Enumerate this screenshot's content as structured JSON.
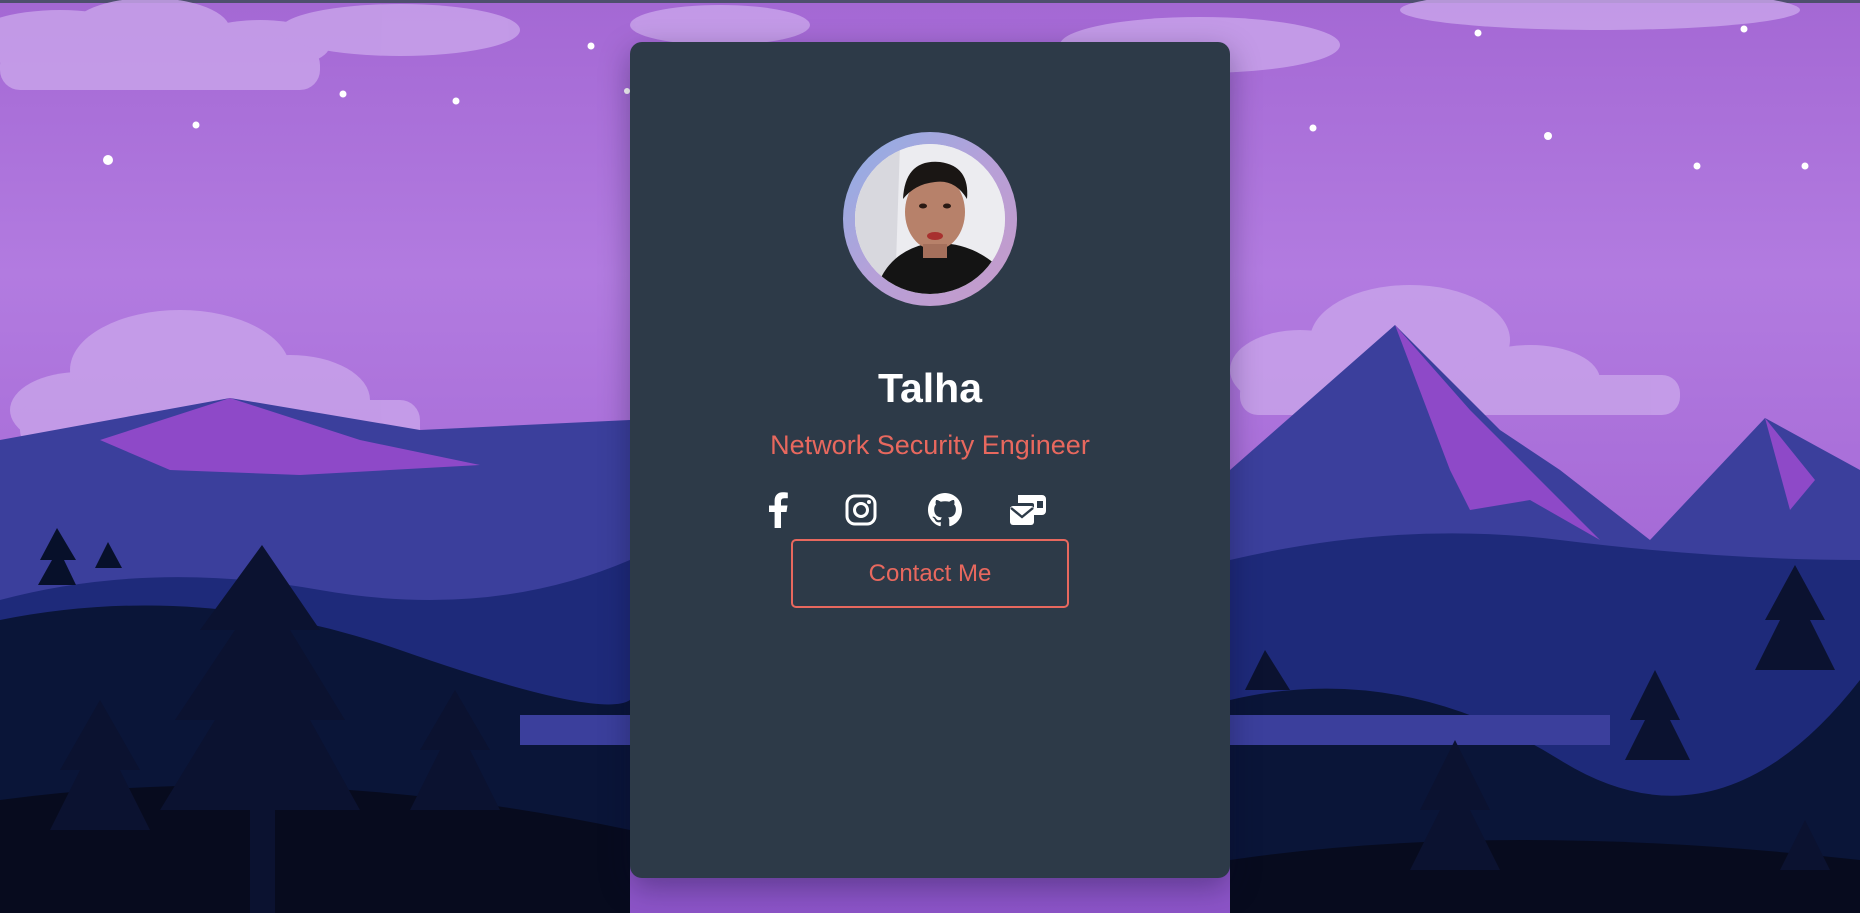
{
  "profile": {
    "name": "Talha",
    "title": "Network Security Engineer",
    "avatar_alt": "Profile photo"
  },
  "socials": [
    {
      "icon": "facebook-icon"
    },
    {
      "icon": "instagram-icon"
    },
    {
      "icon": "github-icon"
    },
    {
      "icon": "email-icon"
    }
  ],
  "contact_button": {
    "label": "Contact Me"
  },
  "colors": {
    "card_bg": "#2d3a48",
    "accent": "#e8685e",
    "name_text": "#ffffff",
    "icon": "#ffffff",
    "sky": "#a86dd8",
    "mountain": "#3b3f9c",
    "foreground": "#07102a"
  }
}
